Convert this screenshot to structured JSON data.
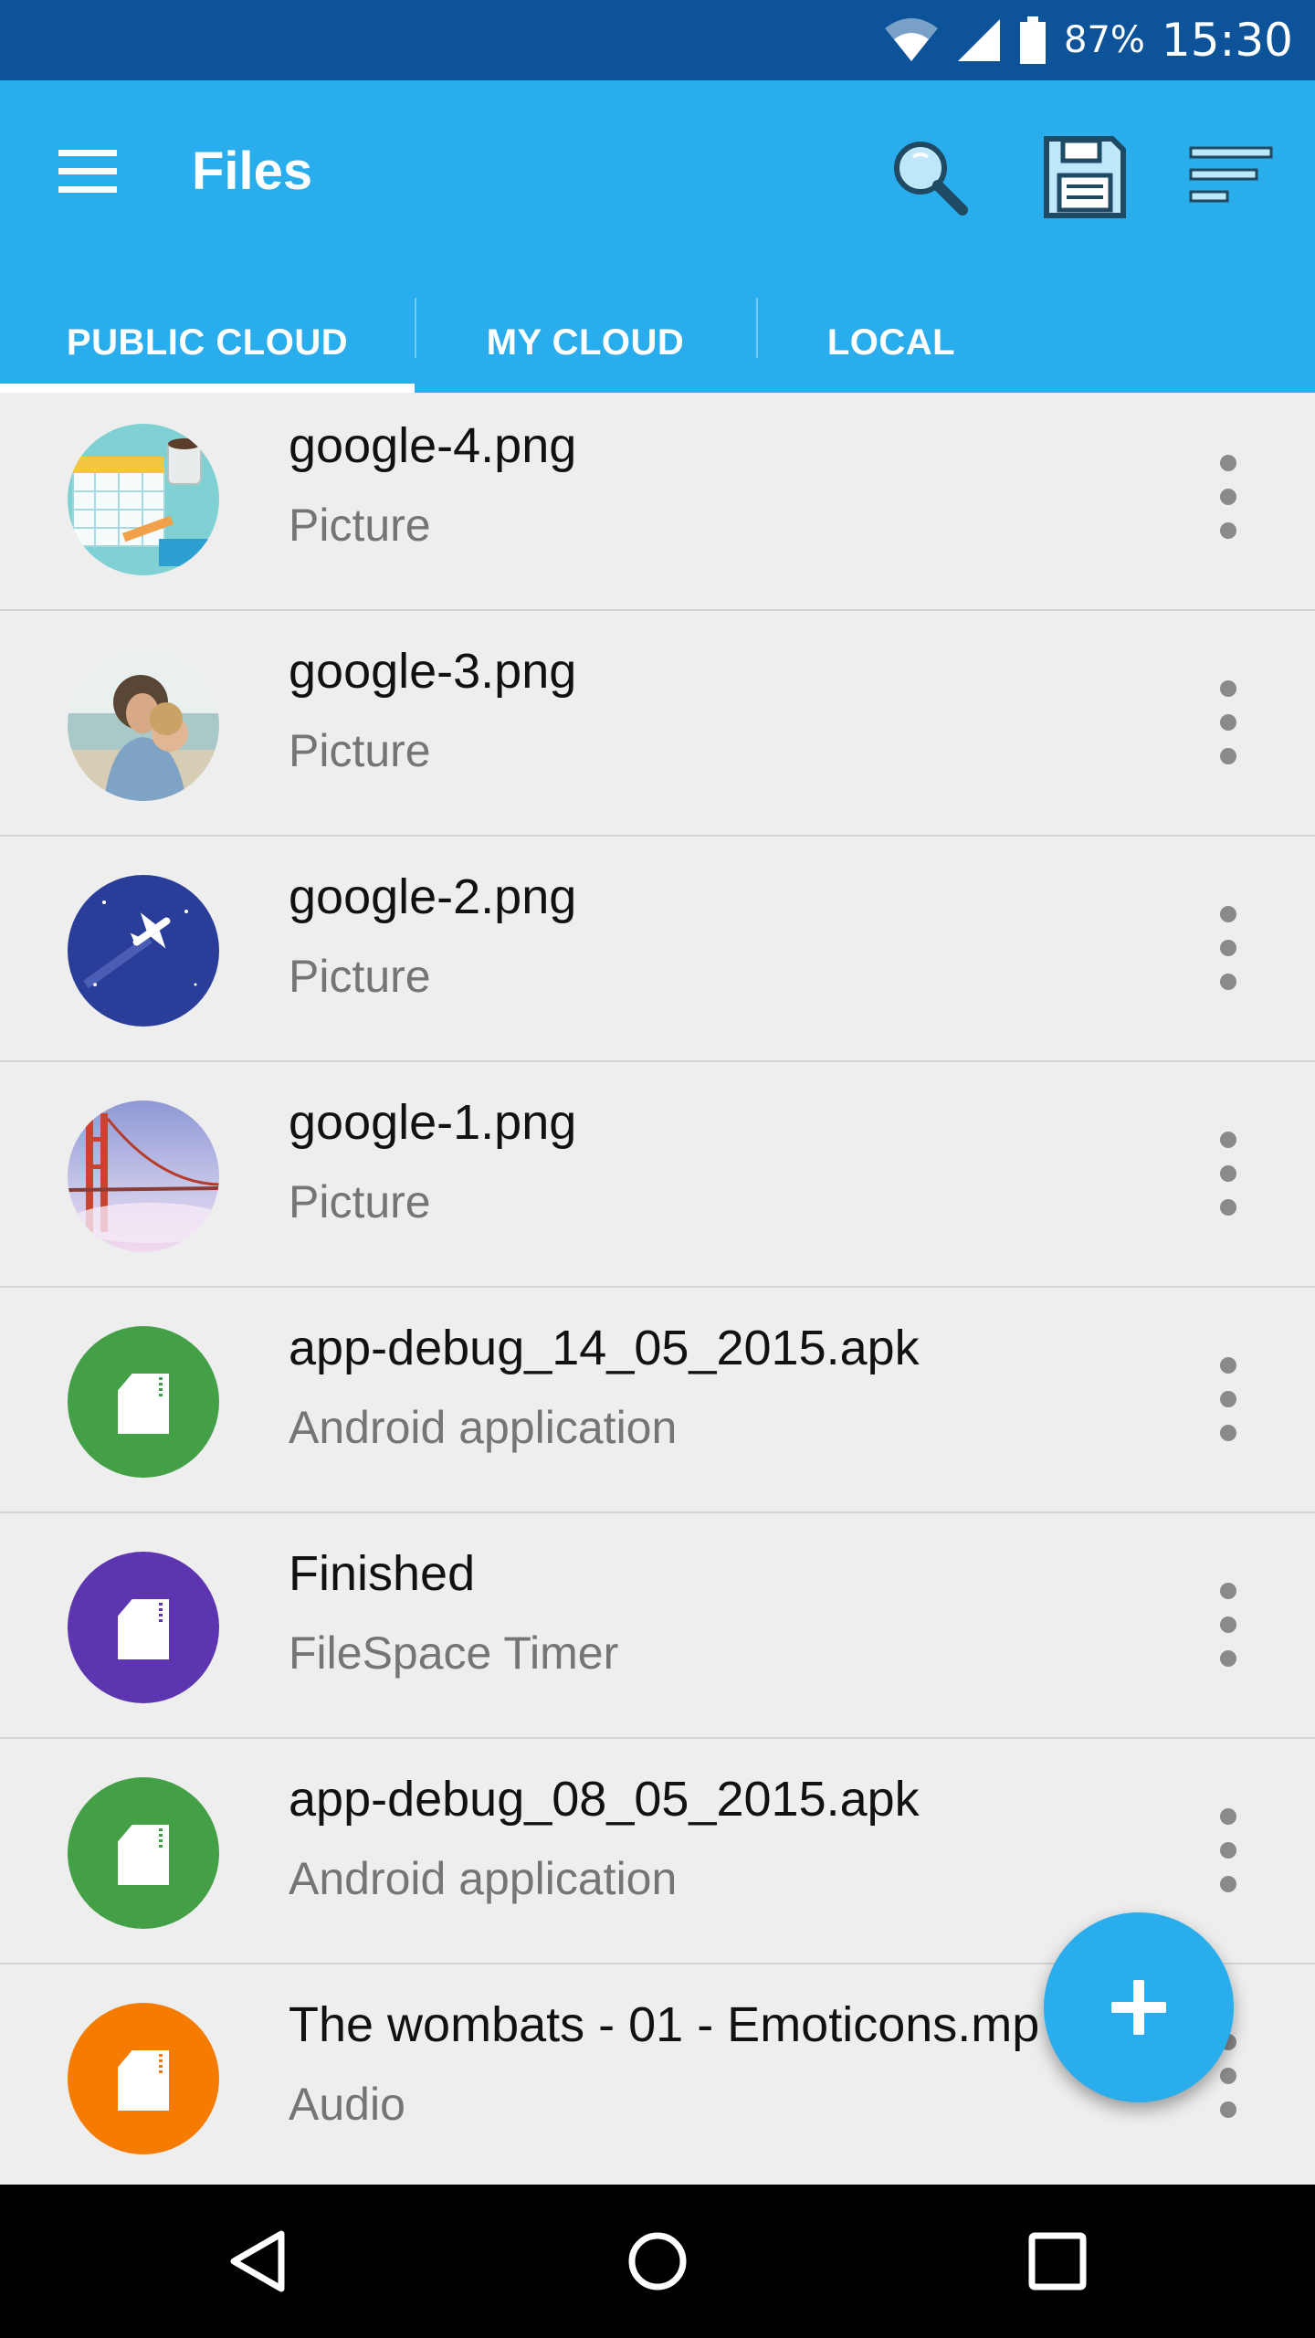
{
  "status_bar": {
    "battery": "87%",
    "time": "15:30"
  },
  "app_bar": {
    "title": "Files",
    "colors": {
      "primary": "#2AADEC",
      "status": "#0C5399"
    }
  },
  "tabs": [
    {
      "label": "PUBLIC CLOUD",
      "selected": true
    },
    {
      "label": "MY CLOUD",
      "selected": false
    },
    {
      "label": "LOCAL",
      "selected": false
    }
  ],
  "files": [
    {
      "name": "google-4.png",
      "type": "Picture",
      "thumb": "calendar-illustration"
    },
    {
      "name": "google-3.png",
      "type": "Picture",
      "thumb": "family-photo"
    },
    {
      "name": "google-2.png",
      "type": "Picture",
      "thumb": "airplane-illustration"
    },
    {
      "name": "google-1.png",
      "type": "Picture",
      "thumb": "bridge-photo"
    },
    {
      "name": "app-debug_14_05_2015.apk",
      "type": "Android application",
      "thumb": "file-icon",
      "color": "#43A047"
    },
    {
      "name": "Finished",
      "type": "FileSpace Timer",
      "thumb": "file-icon",
      "color": "#5E35B1"
    },
    {
      "name": "app-debug_08_05_2015.apk",
      "type": "Android application",
      "thumb": "file-icon",
      "color": "#43A047"
    },
    {
      "name": "The wombats - 01 - Emoticons.mp",
      "type": "Audio",
      "thumb": "file-icon",
      "color": "#F57C00"
    }
  ],
  "fab": {
    "icon": "plus-icon"
  },
  "nav_bar": {
    "icons": [
      "back-icon",
      "home-icon",
      "recents-icon"
    ]
  }
}
